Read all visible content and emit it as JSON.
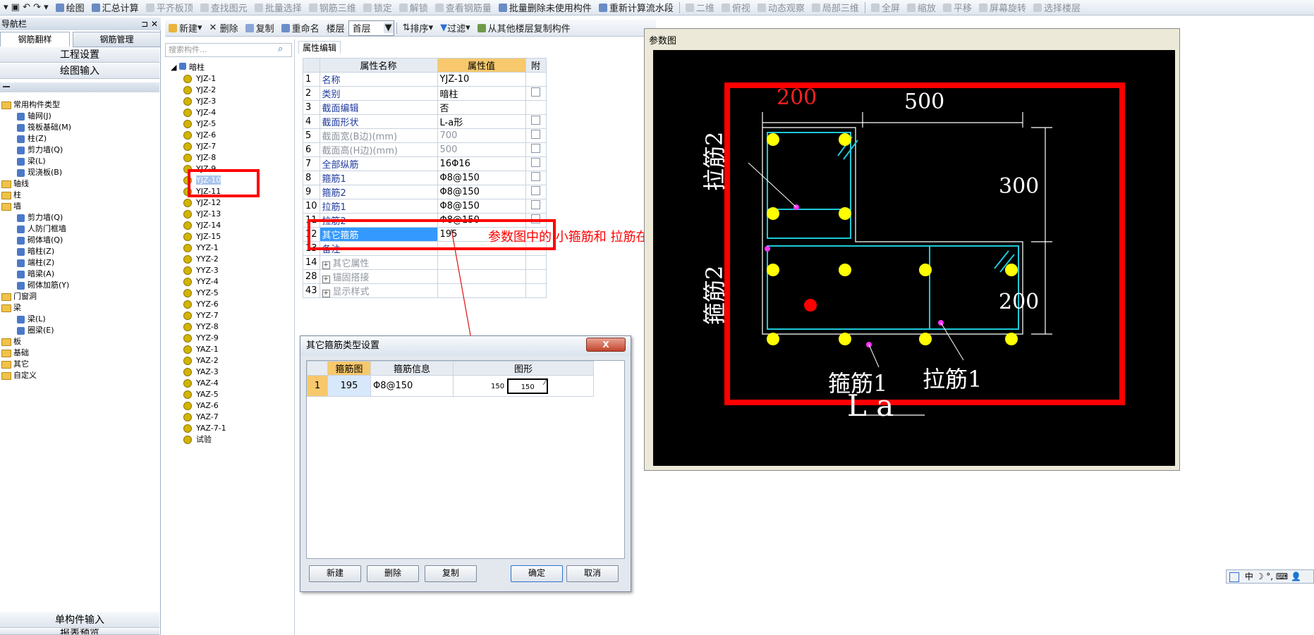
{
  "toolbar1": {
    "items": [
      "绘图",
      "汇总计算",
      "平齐板顶",
      "查找图元",
      "批量选择",
      "钢筋三维",
      "锁定",
      "解锁",
      "查看钢筋量",
      "批量删除未使用构件",
      "重新计算流水段",
      "二维",
      "俯视",
      "动态观察",
      "局部三维",
      "全屏",
      "缩放",
      "平移",
      "屏幕旋转",
      "选择楼层"
    ]
  },
  "toolbar2": {
    "new": "新建",
    "delete": "删除",
    "copy": "复制",
    "rename": "重命名",
    "floor_label": "楼层",
    "floor_value": "首层",
    "sort": "排序",
    "filter": "过滤",
    "copy_from_floor": "从其他楼层复制构件"
  },
  "nav": {
    "title": "导航栏",
    "tabs": [
      "钢筋翻样",
      "钢筋管理"
    ],
    "btn_project": "工程设置",
    "btn_draw": "绘图输入",
    "tree": [
      {
        "label": "常用构件类型",
        "level": 0,
        "type": "folder"
      },
      {
        "label": "轴网(J)",
        "level": 1,
        "type": "leaf"
      },
      {
        "label": "筏板基础(M)",
        "level": 1,
        "type": "leaf"
      },
      {
        "label": "柱(Z)",
        "level": 1,
        "type": "leaf"
      },
      {
        "label": "剪力墙(Q)",
        "level": 1,
        "type": "leaf"
      },
      {
        "label": "梁(L)",
        "level": 1,
        "type": "leaf"
      },
      {
        "label": "现浇板(B)",
        "level": 1,
        "type": "leaf"
      },
      {
        "label": "轴线",
        "level": 0,
        "type": "folder"
      },
      {
        "label": "柱",
        "level": 0,
        "type": "folder"
      },
      {
        "label": "墙",
        "level": 0,
        "type": "folder"
      },
      {
        "label": "剪力墙(Q)",
        "level": 1,
        "type": "leaf"
      },
      {
        "label": "人防门框墙",
        "level": 1,
        "type": "leaf"
      },
      {
        "label": "砌体墙(Q)",
        "level": 1,
        "type": "leaf"
      },
      {
        "label": "暗柱(Z)",
        "level": 1,
        "type": "leaf"
      },
      {
        "label": "端柱(Z)",
        "level": 1,
        "type": "leaf"
      },
      {
        "label": "暗梁(A)",
        "level": 1,
        "type": "leaf"
      },
      {
        "label": "砌体加筋(Y)",
        "level": 1,
        "type": "leaf"
      },
      {
        "label": "门窗洞",
        "level": 0,
        "type": "folder"
      },
      {
        "label": "梁",
        "level": 0,
        "type": "folder"
      },
      {
        "label": "梁(L)",
        "level": 1,
        "type": "leaf"
      },
      {
        "label": "圈梁(E)",
        "level": 1,
        "type": "leaf"
      },
      {
        "label": "板",
        "level": 0,
        "type": "folder"
      },
      {
        "label": "基础",
        "level": 0,
        "type": "folder"
      },
      {
        "label": "其它",
        "level": 0,
        "type": "folder"
      },
      {
        "label": "自定义",
        "level": 0,
        "type": "folder"
      }
    ],
    "btn_single": "单构件输入",
    "btn_report": "报表预览"
  },
  "components": {
    "search_placeholder": "搜索构件...",
    "root": "暗柱",
    "items": [
      "YJZ-1",
      "YJZ-2",
      "YJZ-3",
      "YJZ-4",
      "YJZ-5",
      "YJZ-6",
      "YJZ-7",
      "YJZ-8",
      "YJZ-9",
      "YJZ-10",
      "YJZ-11",
      "YJZ-12",
      "YJZ-13",
      "YJZ-14",
      "YJZ-15",
      "YYZ-1",
      "YYZ-2",
      "YYZ-3",
      "YYZ-4",
      "YYZ-5",
      "YYZ-6",
      "YYZ-7",
      "YYZ-8",
      "YYZ-9",
      "YAZ-1",
      "YAZ-2",
      "YAZ-3",
      "YAZ-4",
      "YAZ-5",
      "YAZ-6",
      "YAZ-7",
      "YAZ-7-1",
      "试验"
    ],
    "selected": "YJZ-10"
  },
  "property": {
    "tab": "属性编辑",
    "headers": [
      "属性名称",
      "属性值",
      "附"
    ],
    "rows": [
      {
        "no": "1",
        "name": "名称",
        "value": "YJZ-10",
        "gray": false,
        "check": false
      },
      {
        "no": "2",
        "name": "类别",
        "value": "暗柱",
        "gray": false,
        "check": true
      },
      {
        "no": "3",
        "name": "截面编辑",
        "value": "否",
        "gray": false,
        "check": false
      },
      {
        "no": "4",
        "name": "截面形状",
        "value": "L-a形",
        "gray": false,
        "check": true
      },
      {
        "no": "5",
        "name": "截面宽(B边)(mm)",
        "value": "700",
        "gray": true,
        "check": true
      },
      {
        "no": "6",
        "name": "截面高(H边)(mm)",
        "value": "500",
        "gray": true,
        "check": true
      },
      {
        "no": "7",
        "name": "全部纵筋",
        "value": "16Φ16",
        "gray": false,
        "check": true
      },
      {
        "no": "8",
        "name": "箍筋1",
        "value": "Φ8@150",
        "gray": false,
        "check": true
      },
      {
        "no": "9",
        "name": "箍筋2",
        "value": "Φ8@150",
        "gray": false,
        "check": true
      },
      {
        "no": "10",
        "name": "拉筋1",
        "value": "Φ8@150",
        "gray": false,
        "check": true
      },
      {
        "no": "11",
        "name": "拉筋2",
        "value": "Φ8@150",
        "gray": false,
        "check": true
      },
      {
        "no": "12",
        "name": "其它箍筋",
        "value": "195",
        "gray": false,
        "check": false
      },
      {
        "no": "13",
        "name": "备注",
        "value": "",
        "gray": false,
        "check": false
      },
      {
        "no": "14",
        "name": "其它属性",
        "value": "",
        "gray": true,
        "check": false
      },
      {
        "no": "28",
        "name": "锚固搭接",
        "value": "",
        "gray": true,
        "check": false
      },
      {
        "no": "43",
        "name": "显示样式",
        "value": "",
        "gray": true,
        "check": false
      }
    ]
  },
  "annotation": "参数图中的 小箍筋和 拉筋在下面的编辑框中输入。",
  "param": {
    "title": "参数图",
    "dim_top_left": "200",
    "dim_top_right": "500",
    "dim_right_top": "300",
    "dim_right_bottom": "200",
    "label_lajin2": "拉筋2",
    "label_gujin2": "箍筋2",
    "label_gujin1": "箍筋1",
    "label_lajin1": "拉筋1",
    "shape_name": "L a"
  },
  "dialog": {
    "title": "其它箍筋类型设置",
    "close": "X",
    "headers": [
      "箍筋图",
      "箍筋信息",
      "图形"
    ],
    "row": {
      "no": "1",
      "fig": "195",
      "info": "Φ8@150",
      "shape_left": "150",
      "shape_inner": "150"
    },
    "btn_new": "新建",
    "btn_delete": "删除",
    "btn_copy": "复制",
    "btn_ok": "确定",
    "btn_cancel": "取消"
  },
  "ime": {
    "text": "中 ☽ °, ⌨ 👤"
  },
  "colors": {
    "accent_red": "#ff0000",
    "highlight_blue": "#3399ff",
    "header_orange": "#f7c86c"
  }
}
